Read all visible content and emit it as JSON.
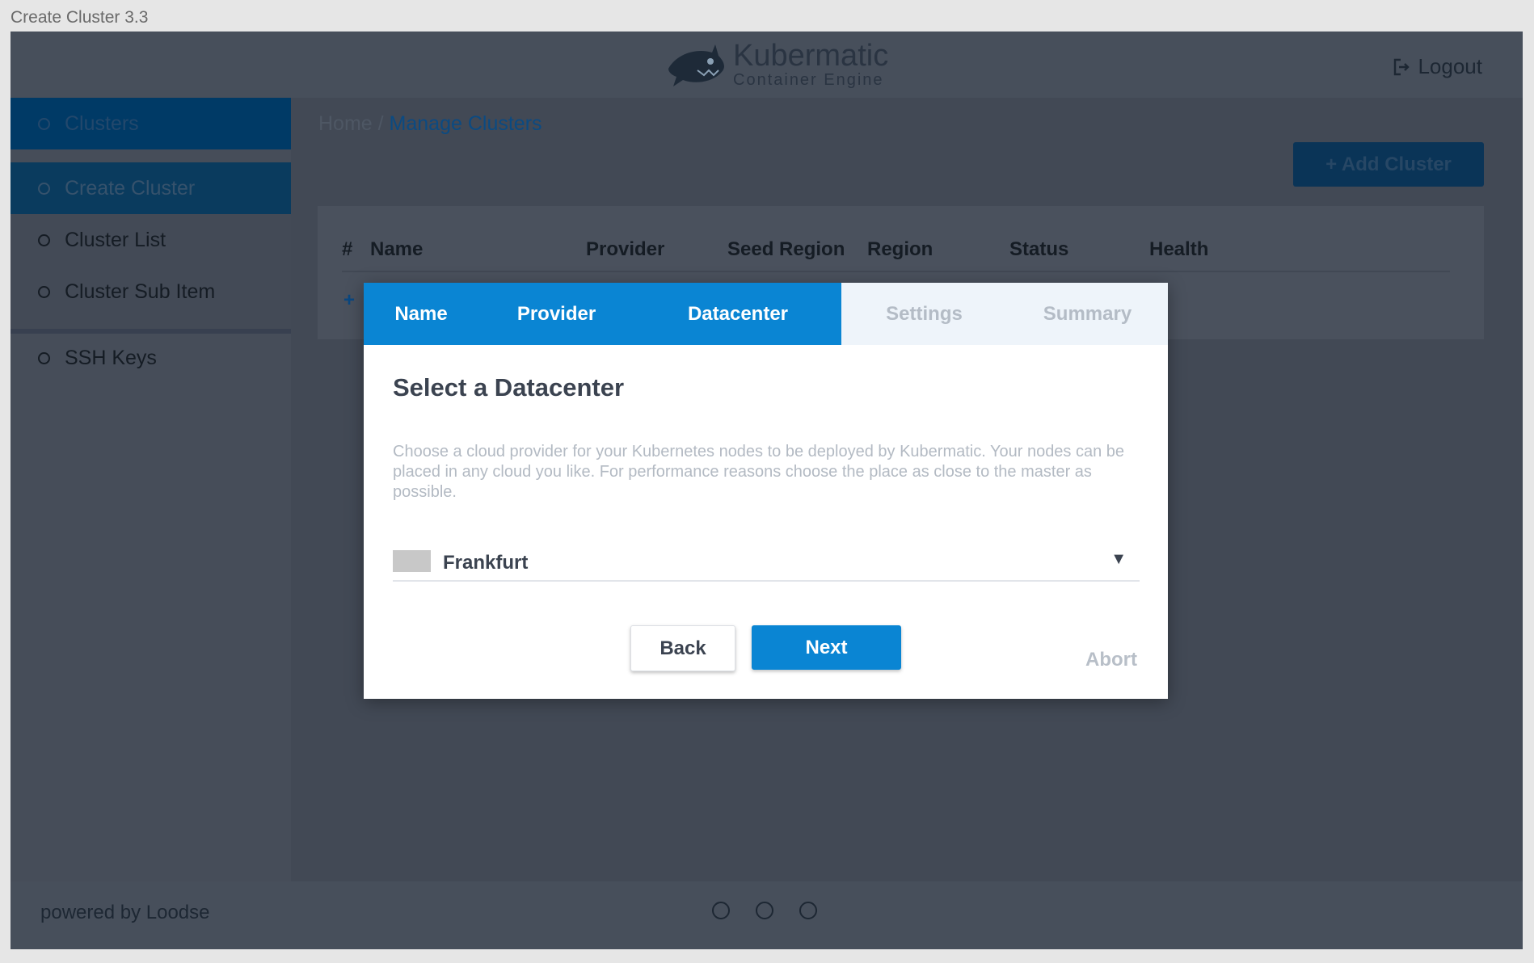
{
  "window": {
    "title": "Create Cluster 3.3"
  },
  "header": {
    "logo_title": "Kubermatic",
    "logo_subtitle": "Container Engine",
    "logout_label": "Logout"
  },
  "sidebar": {
    "items": [
      {
        "label": "Clusters"
      },
      {
        "label": "Create Cluster"
      },
      {
        "label": "Cluster List"
      },
      {
        "label": "Cluster Sub Item"
      },
      {
        "label": "SSH Keys"
      }
    ]
  },
  "breadcrumb": {
    "home": "Home",
    "separator": "/",
    "current": "Manage Clusters"
  },
  "toolbar": {
    "add_cluster_label": "+ Add Cluster"
  },
  "table": {
    "columns": [
      "#",
      "Name",
      "Provider",
      "Seed Region",
      "Region",
      "Status",
      "Health"
    ],
    "add_row_prefix": "+"
  },
  "wizard": {
    "steps": [
      {
        "label": "Name",
        "state": "done"
      },
      {
        "label": "Provider",
        "state": "done"
      },
      {
        "label": "Datacenter",
        "state": "active"
      },
      {
        "label": "Settings",
        "state": "pending"
      },
      {
        "label": "Summary",
        "state": "pending"
      }
    ],
    "title": "Select a Datacenter",
    "description": "Choose a cloud provider for your Kubernetes nodes to be deployed by Kubermatic. Your nodes can be placed in any cloud you like. For performance reasons choose the place as close to the master as possible.",
    "datacenter_select": {
      "value": "Frankfurt",
      "caret": "▼"
    },
    "back_label": "Back",
    "next_label": "Next",
    "abort_label": "Abort"
  },
  "footer": {
    "powered_by": "powered by Loodse",
    "pager_dots": 3
  },
  "colors": {
    "primary": "#0a85d3",
    "overlay_bg": "#424955",
    "sidebar_active": "#003a66"
  }
}
